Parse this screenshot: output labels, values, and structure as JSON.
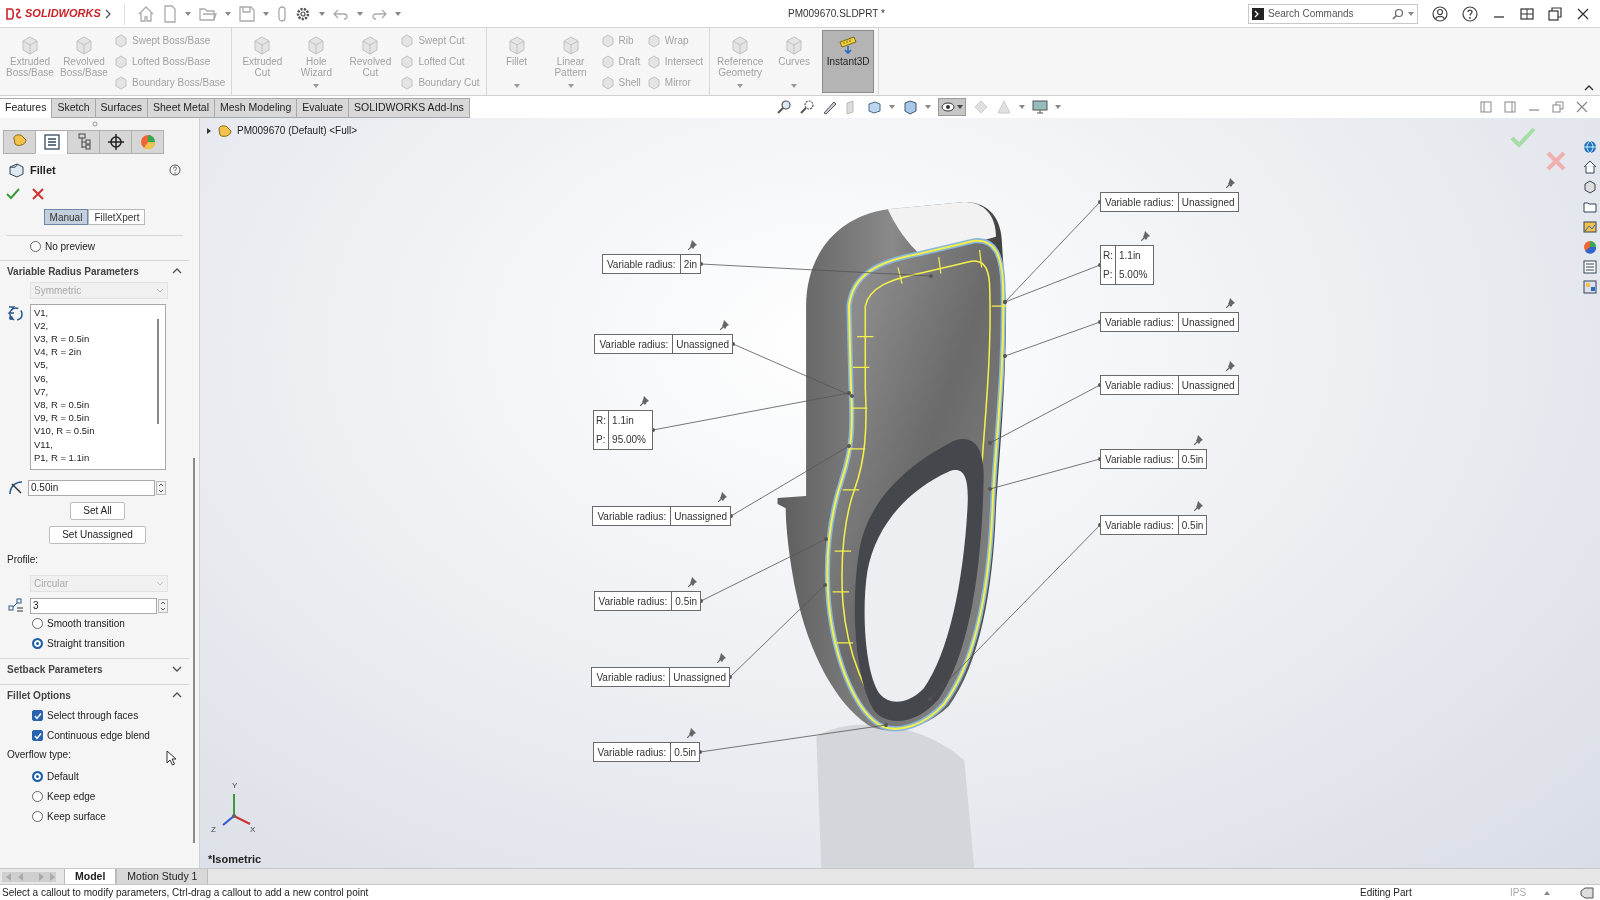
{
  "title_bar": {
    "app_name": "SOLIDWORKS",
    "document_title": "PM009670.SLDPRT *",
    "search": {
      "placeholder": "Search Commands"
    }
  },
  "ribbon": {
    "groups": [
      {
        "columns": [
          {
            "kind": "large",
            "label": "Extruded Boss/Base",
            "disabled": true,
            "selected": false,
            "dropdown": false
          },
          {
            "kind": "large",
            "label": "Revolved Boss/Base",
            "disabled": true,
            "selected": false,
            "dropdown": false
          },
          {
            "kind": "stack",
            "items": [
              {
                "label": "Swept Boss/Base",
                "disabled": true
              },
              {
                "label": "Lofted Boss/Base",
                "disabled": true
              },
              {
                "label": "Boundary Boss/Base",
                "disabled": true
              }
            ]
          }
        ]
      },
      {
        "columns": [
          {
            "kind": "large",
            "label": "Extruded Cut",
            "disabled": true,
            "selected": false,
            "dropdown": false
          },
          {
            "kind": "large",
            "label": "Hole Wizard",
            "disabled": true,
            "selected": false,
            "dropdown": true
          },
          {
            "kind": "large",
            "label": "Revolved Cut",
            "disabled": true,
            "selected": false,
            "dropdown": false
          },
          {
            "kind": "stack",
            "items": [
              {
                "label": "Swept Cut",
                "disabled": true
              },
              {
                "label": "Lofted Cut",
                "disabled": true
              },
              {
                "label": "Boundary Cut",
                "disabled": true
              }
            ]
          }
        ]
      },
      {
        "columns": [
          {
            "kind": "large",
            "label": "Fillet",
            "disabled": true,
            "selected": false,
            "dropdown": true
          },
          {
            "kind": "large",
            "label": "Linear Pattern",
            "disabled": true,
            "selected": false,
            "dropdown": true
          },
          {
            "kind": "stack",
            "items": [
              {
                "label": "Rib",
                "disabled": true
              },
              {
                "label": "Draft",
                "disabled": true
              },
              {
                "label": "Shell",
                "disabled": true
              }
            ]
          },
          {
            "kind": "stack",
            "items": [
              {
                "label": "Wrap",
                "disabled": true
              },
              {
                "label": "Intersect",
                "disabled": true
              },
              {
                "label": "Mirror",
                "disabled": true
              }
            ]
          }
        ]
      },
      {
        "columns": [
          {
            "kind": "large",
            "label": "Reference Geometry",
            "disabled": true,
            "selected": false,
            "dropdown": true
          },
          {
            "kind": "large",
            "label": "Curves",
            "disabled": true,
            "selected": false,
            "dropdown": true
          },
          {
            "kind": "large",
            "label": "Instant3D",
            "disabled": false,
            "selected": true,
            "dropdown": false
          }
        ]
      }
    ]
  },
  "command_tabs": [
    {
      "label": "Features",
      "selected": true
    },
    {
      "label": "Sketch",
      "selected": false
    },
    {
      "label": "Surfaces",
      "selected": false
    },
    {
      "label": "Sheet Metal",
      "selected": false
    },
    {
      "label": "Mesh Modeling",
      "selected": false
    },
    {
      "label": "Evaluate",
      "selected": false
    },
    {
      "label": "SOLIDWORKS Add-Ins",
      "selected": false
    }
  ],
  "panel": {
    "tabs": [
      {
        "kind": "feature-tree",
        "selected": false
      },
      {
        "kind": "property-manager",
        "selected": true
      },
      {
        "kind": "configuration",
        "selected": false
      },
      {
        "kind": "dimxpert",
        "selected": false
      },
      {
        "kind": "display",
        "selected": false
      }
    ],
    "title": "Fillet",
    "modes": [
      {
        "label": "Manual",
        "selected": true
      },
      {
        "label": "FilletXpert",
        "selected": false
      }
    ],
    "preview_option": {
      "label": "No preview",
      "selected": false
    },
    "variable_radius": {
      "title": "Variable Radius Parameters",
      "expanded": true,
      "type_dropdown": {
        "value": "Symmetric",
        "disabled": true
      },
      "vertices": [
        "V1,",
        "V2,",
        "V3, R = 0.5in",
        "V4, R = 2in",
        "V5,",
        "V6,",
        "V7,",
        "V8, R = 0.5in",
        "V9, R = 0.5in",
        "V10, R = 0.5in",
        "V11,",
        "P1, R = 1.1in"
      ],
      "radius": "0.50in",
      "buttons": [
        "Set All",
        "Set Unassigned"
      ],
      "profile_label": "Profile:",
      "profile_dropdown": {
        "value": "Circular",
        "disabled": true
      },
      "instances": "3",
      "transitions": [
        {
          "label": "Smooth transition",
          "selected": false
        },
        {
          "label": "Straight transition",
          "selected": true
        }
      ]
    },
    "setback": {
      "title": "Setback Parameters",
      "expanded": false
    },
    "fillet_options": {
      "title": "Fillet Options",
      "expanded": true,
      "checkboxes": [
        {
          "label": "Select through faces",
          "checked": true
        },
        {
          "label": "Continuous edge blend",
          "checked": true
        }
      ],
      "overflow_label": "Overflow type:",
      "overflow_options": [
        {
          "label": "Default",
          "selected": true
        },
        {
          "label": "Keep edge",
          "selected": false
        },
        {
          "label": "Keep surface",
          "selected": false
        }
      ]
    }
  },
  "viewport": {
    "breadcrumb": "PM009670 (Default) <Full>",
    "view_name": "*Isometric",
    "triad_labels": [
      "Y",
      "Z",
      "X"
    ],
    "callouts": [
      {
        "kind": "radius",
        "label": "Variable radius:",
        "value": "2in"
      },
      {
        "kind": "radius",
        "label": "Variable radius:",
        "value": "Unassigned"
      },
      {
        "kind": "rp",
        "rows": [
          {
            "label": "R:",
            "value": "1.1in"
          },
          {
            "label": "P:",
            "value": "95.00%"
          }
        ]
      },
      {
        "kind": "radius",
        "label": "Variable radius:",
        "value": "Unassigned"
      },
      {
        "kind": "radius",
        "label": "Variable radius:",
        "value": "0.5in"
      },
      {
        "kind": "radius",
        "label": "Variable radius:",
        "value": "Unassigned"
      },
      {
        "kind": "radius",
        "label": "Variable radius:",
        "value": "0.5in"
      },
      {
        "kind": "radius",
        "label": "Variable radius:",
        "value": "Unassigned"
      },
      {
        "kind": "rp",
        "rows": [
          {
            "label": "R:",
            "value": "1.1in"
          },
          {
            "label": "P:",
            "value": "5.00%"
          }
        ]
      },
      {
        "kind": "radius",
        "label": "Variable radius:",
        "value": "Unassigned"
      },
      {
        "kind": "radius",
        "label": "Variable radius:",
        "value": "Unassigned"
      },
      {
        "kind": "radius",
        "label": "Variable radius:",
        "value": "0.5in"
      },
      {
        "kind": "radius",
        "label": "Variable radius:",
        "value": "0.5in"
      }
    ]
  },
  "bottom_tabs": [
    {
      "label": "Model",
      "selected": true
    },
    {
      "label": "Motion Study 1",
      "selected": false
    }
  ],
  "status_bar": {
    "message": "Select a callout to modify parameters, Ctrl-drag a callout to add a new control point",
    "mode": "Editing Part",
    "units": "IPS"
  }
}
